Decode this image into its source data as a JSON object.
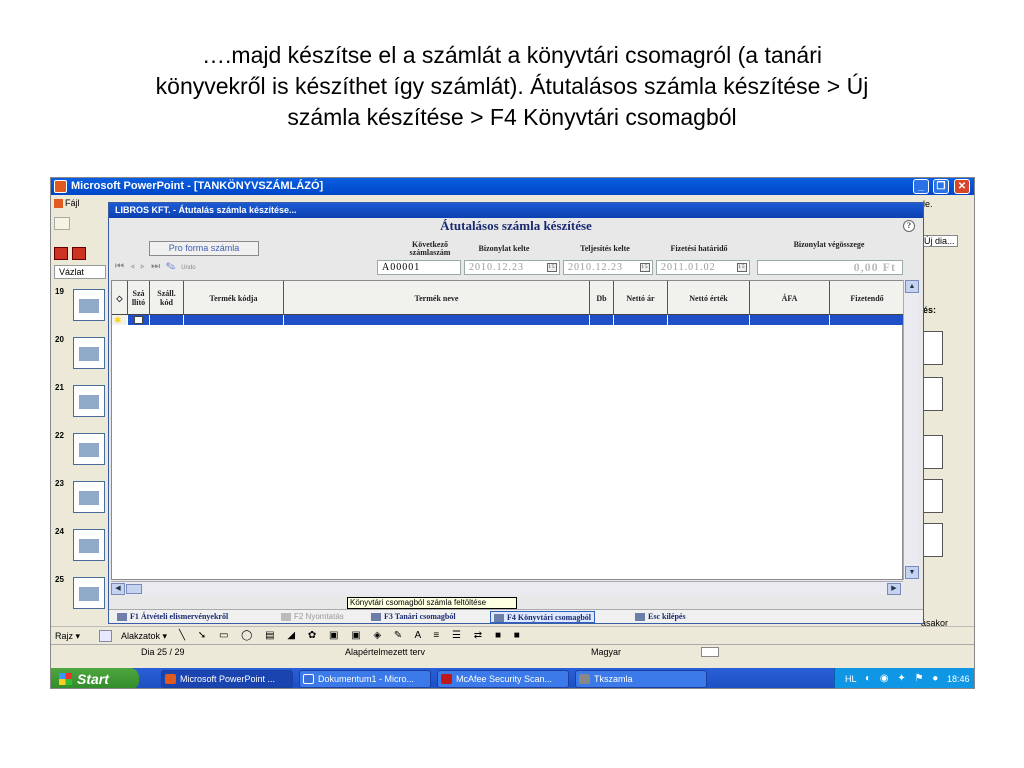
{
  "caption": {
    "line1": "….majd készítse el a számlát a könyvtári csomagról (a tanári",
    "line2": "könyvekről is készíthet így számlát). Átutalásos számla készítése > Új",
    "line3": "számla készítése > F4 Könyvtári csomagból"
  },
  "ppt": {
    "title": "Microsoft PowerPoint - [TANKÖNYVSZÁMLÁZÓ]",
    "menu_first": "Fájl",
    "tab_outline": "Vázlat",
    "slide_numbers": [
      "19",
      "20",
      "21",
      "22",
      "23",
      "24",
      "25"
    ],
    "right_pane_text_1": "le.",
    "right_pane_text_2": "Új dia...",
    "right_pane_text_3": "és:",
    "right_pane_text_4": "ásakor"
  },
  "dialog": {
    "window_title": "LIBROS KFT.  -  Átutalás számla készítése...",
    "heading": "Átutalásos számla készítése",
    "help": "?",
    "proforma_button": "Pro forma számla",
    "small_icon_label": "Undo",
    "fields": {
      "next_invoice_label": "Következő számlaszám",
      "next_invoice_value": "A00001",
      "doc_date_label": "Bizonylat kelte",
      "doc_date_value": "2010.12.23",
      "perf_date_label": "Teljesítés kelte",
      "perf_date_value": "2010.12.23",
      "due_date_label": "Fizetési határidő",
      "due_date_value": "2011.01.02",
      "total_label": "Bizonylat végösszege",
      "total_value": "0,00 Ft"
    },
    "columns": {
      "supplier": "Szá llító",
      "supplier_code": "Száll. kód",
      "product_code": "Termék kódja",
      "product_name": "Termék neve",
      "qty": "Db",
      "net_price": "Nettó ár",
      "net_value": "Nettó érték",
      "vat": "ÁFA",
      "payable": "Fizetendő"
    },
    "tooltip": "Könyvtári csomagból számla feltöltése",
    "fkeys": {
      "f1": "F1 Átvételi elismervényekről",
      "f2": "F2 Nyomtatás",
      "f3": "F3 Tanári csomagból",
      "f4": "F4 Könyvtári csomagból",
      "esc": "Esc kilépés"
    }
  },
  "drawbar": {
    "draw": "Rajz ▾",
    "autoshapes": "Alakzatok ▾"
  },
  "status": {
    "slide": "Dia 25 / 29",
    "design": "Alapértelmezett terv",
    "language": "Magyar"
  },
  "taskbar": {
    "start": "Start",
    "tasks": [
      "Microsoft PowerPoint ...",
      "Dokumentum1 - Micro...",
      "McAfee Security Scan...",
      "Tkszamla"
    ],
    "tray_lang": "HL",
    "clock": "18:46"
  }
}
